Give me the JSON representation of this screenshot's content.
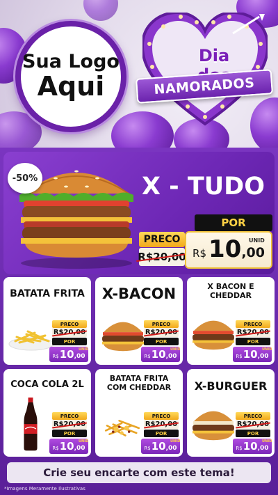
{
  "logo": {
    "line1": "Sua Logo",
    "line2": "Aqui"
  },
  "theme": {
    "line1": "Dia dos",
    "line2": "NAMORADOS"
  },
  "featured": {
    "title": "X - TUDO",
    "discount": "-50%",
    "preco_label": "PRECO",
    "old_price": "R$20,00",
    "por_label": "POR",
    "currency": "R$",
    "price_int": "10",
    "price_dec": ",00",
    "unit": "UNID"
  },
  "items": [
    {
      "title": "BATATA FRITA",
      "image": "fries-icon",
      "preco_label": "PRECO",
      "old_price": "R$20,00",
      "por_label": "POR",
      "currency": "R$",
      "price_int": "10",
      "price_dec": ",00",
      "unit": "UNID"
    },
    {
      "title": "X-BACON",
      "image": "bacon-burger-icon",
      "preco_label": "PRECO",
      "old_price": "R$20,00",
      "por_label": "POR",
      "currency": "R$",
      "price_int": "10",
      "price_dec": ",00",
      "unit": "UNID"
    },
    {
      "title": "X BACON E CHEDDAR",
      "image": "cheddar-burger-icon",
      "preco_label": "PRECO",
      "old_price": "R$20,00",
      "por_label": "POR",
      "currency": "R$",
      "price_int": "10",
      "price_dec": ",00",
      "unit": "UNID"
    },
    {
      "title": "COCA COLA 2L",
      "image": "cola-bottle-icon",
      "preco_label": "PRECO",
      "old_price": "R$20,00",
      "por_label": "POR",
      "currency": "R$",
      "price_int": "10",
      "price_dec": ",00",
      "unit": "UNID"
    },
    {
      "title": "BATATA FRITA COM CHEDDAR",
      "image": "cheddar-fries-icon",
      "preco_label": "PRECO",
      "old_price": "R$20,00",
      "por_label": "POR",
      "currency": "R$",
      "price_int": "10",
      "price_dec": ",00",
      "unit": "UNID"
    },
    {
      "title": "X-BURGUER",
      "image": "burger-icon",
      "preco_label": "PRECO",
      "old_price": "R$20,00",
      "por_label": "POR",
      "currency": "R$",
      "price_int": "10",
      "price_dec": ",00",
      "unit": "UNID"
    }
  ],
  "cta": "Crie seu encarte com este tema!",
  "disclaimer": "*Imagens Meramente Ilustrativas",
  "colors": {
    "primary_purple": "#6d2bb0",
    "accent_gold": "#ffd245",
    "price_purple": "#9b3ccf"
  }
}
